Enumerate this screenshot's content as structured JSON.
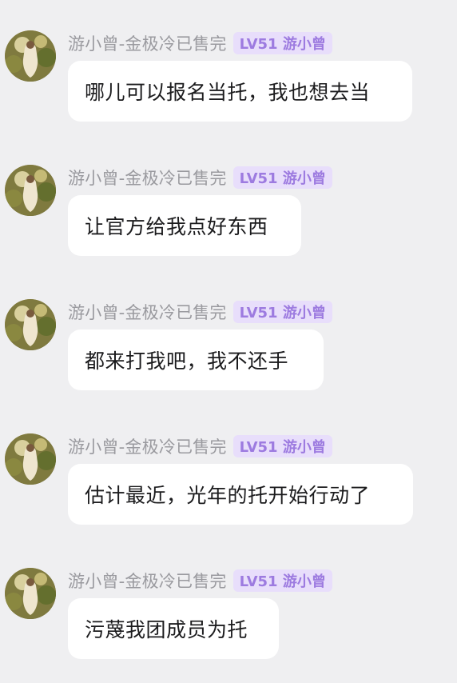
{
  "messages": [
    {
      "username": "游小曾-金极冷已售完",
      "badge": "LV51 游小曾",
      "text": "哪儿可以报名当托，我也想去当"
    },
    {
      "username": "游小曾-金极冷已售完",
      "badge": "LV51 游小曾",
      "text": "让官方给我点好东西"
    },
    {
      "username": "游小曾-金极冷已售完",
      "badge": "LV51 游小曾",
      "text": "都来打我吧，我不还手"
    },
    {
      "username": "游小曾-金极冷已售完",
      "badge": "LV51 游小曾",
      "text": "估计最近，光年的托开始行动了"
    },
    {
      "username": "游小曾-金极冷已售完",
      "badge": "LV51 游小曾",
      "text": "污蔑我团成员为托"
    }
  ],
  "colors": {
    "background": "#efeff1",
    "bubble": "#ffffff",
    "name": "#9a9a9f",
    "badge_bg": "#e8defb",
    "badge_text": "#9d7be0",
    "message_text": "#1b1b1d"
  },
  "icons": {
    "avatar": "user-avatar-icon"
  }
}
